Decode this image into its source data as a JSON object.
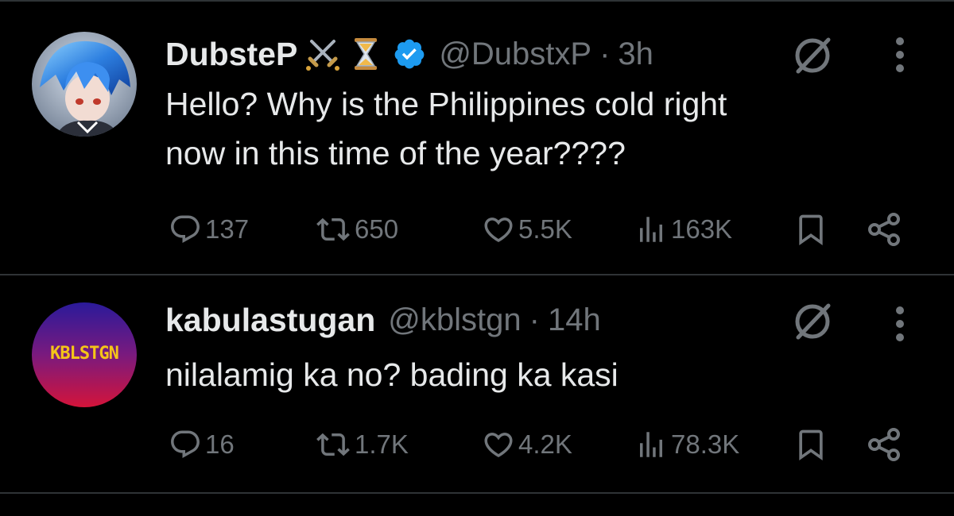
{
  "tweets": [
    {
      "display_name": "DubsteP",
      "name_emojis": [
        "crossed-swords-icon",
        "hourglass-icon"
      ],
      "verified": true,
      "handle": "@DubstxP",
      "separator": "·",
      "time": "3h",
      "text": "Hello? Why is the Philippines cold right\nnow in this time of the year????",
      "replies": "137",
      "reposts": "650",
      "likes": "5.5K",
      "views": "163K"
    },
    {
      "display_name": "kabulastugan",
      "verified": false,
      "handle": "@kblstgn",
      "separator": "·",
      "time": "14h",
      "text": "nilalamig ka no? bading ka kasi",
      "avatar_text": "KBLSTGN",
      "replies": "16",
      "reposts": "1.7K",
      "likes": "4.2K",
      "views": "78.3K"
    }
  ],
  "colors": {
    "background": "#000000",
    "text": "#e7e9ea",
    "muted": "#71767b",
    "divider": "#2f3336",
    "verified": "#1d9bf0"
  }
}
